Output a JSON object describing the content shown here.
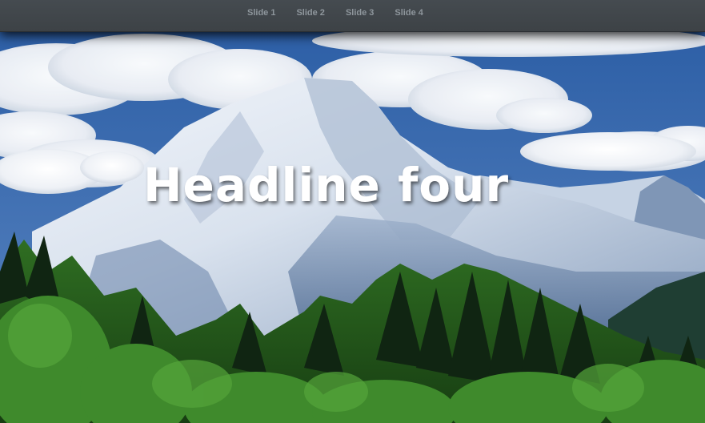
{
  "nav": {
    "items": [
      {
        "label": "Slide 1"
      },
      {
        "label": "Slide 2"
      },
      {
        "label": "Slide 3"
      },
      {
        "label": "Slide 4"
      }
    ]
  },
  "slide": {
    "headline": "Headline four",
    "image": "snow-mountain-landscape"
  },
  "colors": {
    "topbar": "#41464a",
    "nav_text": "#8e969c",
    "sky": "#3e6db0",
    "snow": "#e8eef6",
    "forest": "#2f6b22"
  }
}
